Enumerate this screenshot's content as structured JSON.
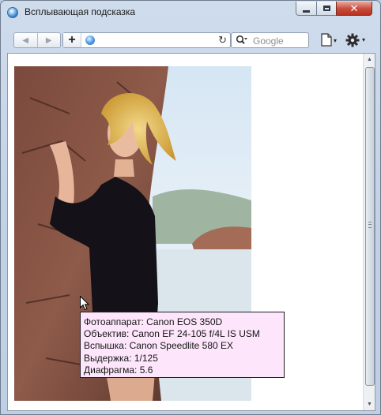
{
  "window": {
    "title": "Всплывающая подсказка",
    "buttons": {
      "minimize": "minimize",
      "maximize": "maximize",
      "close": "✕"
    }
  },
  "toolbar": {
    "back_icon": "◀",
    "forward_icon": "▶",
    "add_label": "+",
    "address_value": "",
    "reload_icon": "↻",
    "search_placeholder": "Google",
    "page_menu_icon": "page-icon",
    "tools_menu_icon": "gear-icon",
    "caret": "▾"
  },
  "scrollbar": {
    "up": "▲",
    "down": "▼"
  },
  "tooltip": {
    "lines": [
      "Фотоаппарат: Canon EOS 350D",
      "Объектив: Canon EF 24-105 f/4L IS USM",
      "Вспышка: Canon Speedlite 580 EX",
      "Выдержка: 1/125",
      "Диафрагма: 5.6"
    ]
  },
  "colors": {
    "tooltip_background": "#fde6fb",
    "tooltip_border": "#1e1e1e",
    "frame": "#bfd0e5",
    "close_button": "#c8493a"
  }
}
